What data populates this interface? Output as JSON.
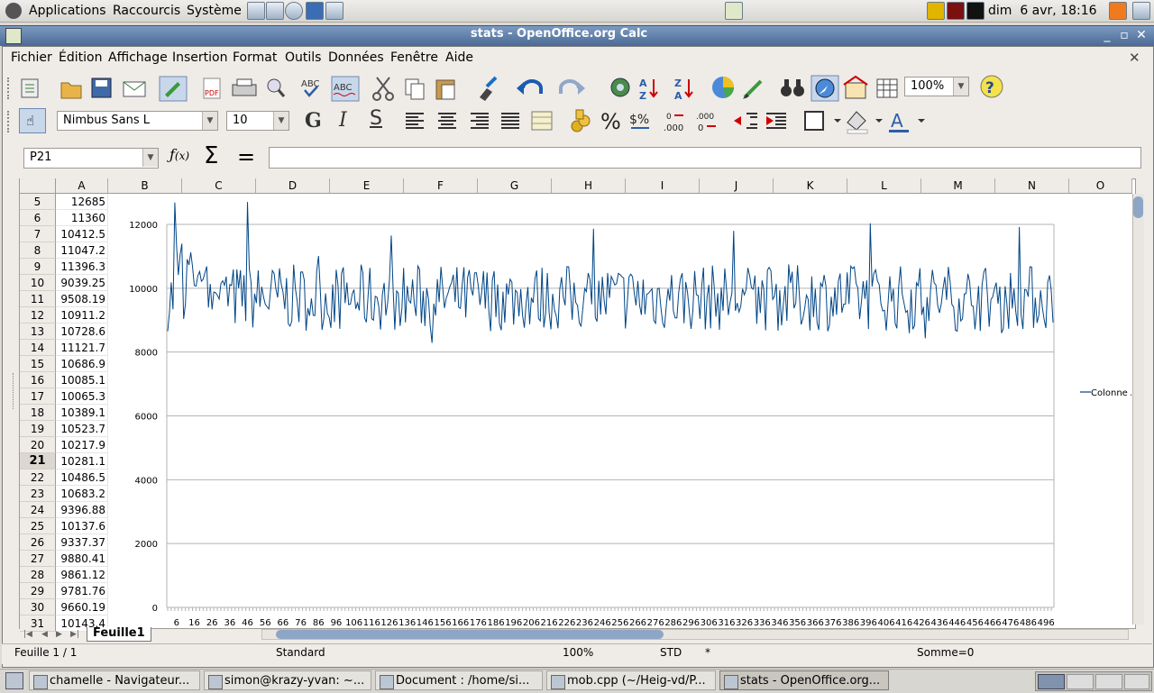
{
  "top_panel": {
    "menus": [
      "Applications",
      "Raccourcis",
      "Système"
    ],
    "clock": "dim  6 avr, 18:16"
  },
  "window": {
    "title": "stats - OpenOffice.org Calc"
  },
  "menubar": [
    "Fichier",
    "Édition",
    "Affichage",
    "Insertion",
    "Format",
    "Outils",
    "Données",
    "Fenêtre",
    "Aide"
  ],
  "toolbar": {
    "zoom": "100%"
  },
  "format_bar": {
    "font_name": "Nimbus Sans L",
    "font_size": "10",
    "bold": "G",
    "italic": "I",
    "underline": "S"
  },
  "formula_bar": {
    "cell_ref": "P21",
    "sigma": "Σ",
    "equals": "=",
    "content": ""
  },
  "columns": [
    "A",
    "B",
    "C",
    "D",
    "E",
    "F",
    "G",
    "H",
    "I",
    "J",
    "K",
    "L",
    "M",
    "N",
    "O"
  ],
  "rows": [
    {
      "n": "5",
      "a": "12685"
    },
    {
      "n": "6",
      "a": "11360"
    },
    {
      "n": "7",
      "a": "10412.5"
    },
    {
      "n": "8",
      "a": "11047.2"
    },
    {
      "n": "9",
      "a": "11396.3"
    },
    {
      "n": "10",
      "a": "9039.25"
    },
    {
      "n": "11",
      "a": "9508.19"
    },
    {
      "n": "12",
      "a": "10911.2"
    },
    {
      "n": "13",
      "a": "10728.6"
    },
    {
      "n": "14",
      "a": "11121.7"
    },
    {
      "n": "15",
      "a": "10686.9"
    },
    {
      "n": "16",
      "a": "10085.1"
    },
    {
      "n": "17",
      "a": "10065.3"
    },
    {
      "n": "18",
      "a": "10389.1"
    },
    {
      "n": "19",
      "a": "10523.7"
    },
    {
      "n": "20",
      "a": "10217.9"
    },
    {
      "n": "21",
      "a": "10281.1"
    },
    {
      "n": "22",
      "a": "10486.5"
    },
    {
      "n": "23",
      "a": "10683.2"
    },
    {
      "n": "24",
      "a": "9396.88"
    },
    {
      "n": "25",
      "a": "10137.6"
    },
    {
      "n": "26",
      "a": "9337.37"
    },
    {
      "n": "27",
      "a": "9880.41"
    },
    {
      "n": "28",
      "a": "9861.12"
    },
    {
      "n": "29",
      "a": "9781.76"
    },
    {
      "n": "30",
      "a": "9660.19"
    },
    {
      "n": "31",
      "a": "10143.4"
    }
  ],
  "active_row": "21",
  "chart_data": {
    "type": "line",
    "series": [
      {
        "name": "Colonne A",
        "color": "#004586"
      }
    ],
    "ylim": [
      0,
      12000
    ],
    "yticks": [
      "0",
      "2000",
      "4000",
      "6000",
      "8000",
      "10000",
      "12000"
    ],
    "xticks": [
      "6",
      "16",
      "26",
      "36",
      "46",
      "56",
      "66",
      "76",
      "86",
      "96",
      "106",
      "116",
      "126",
      "136",
      "146",
      "156",
      "166",
      "176",
      "186",
      "196",
      "206",
      "216",
      "226",
      "236",
      "246",
      "256",
      "266",
      "276",
      "286",
      "296",
      "306",
      "316",
      "326",
      "336",
      "346",
      "356",
      "366",
      "376",
      "386",
      "396",
      "406",
      "416",
      "426",
      "436",
      "446",
      "456",
      "466",
      "476",
      "486",
      "496"
    ],
    "x_start": 1,
    "x_end": 500,
    "values_note_free": true,
    "y_range_observed": [
      8100,
      12750
    ],
    "grid": true,
    "legend": "right"
  },
  "sheet_tabs": [
    "Feuille1"
  ],
  "status": {
    "sheet": "Feuille 1 / 1",
    "style": "Standard",
    "zoom": "100%",
    "mode": "STD",
    "modified": "*",
    "sum": "Somme=0"
  },
  "taskbar": [
    {
      "label": "chamelle - Navigateur...",
      "active": false
    },
    {
      "label": "simon@krazy-yvan: ~...",
      "active": false
    },
    {
      "label": "Document : /home/si...",
      "active": false
    },
    {
      "label": "mob.cpp (~/Heig-vd/P...",
      "active": false
    },
    {
      "label": "stats - OpenOffice.org...",
      "active": true
    }
  ]
}
